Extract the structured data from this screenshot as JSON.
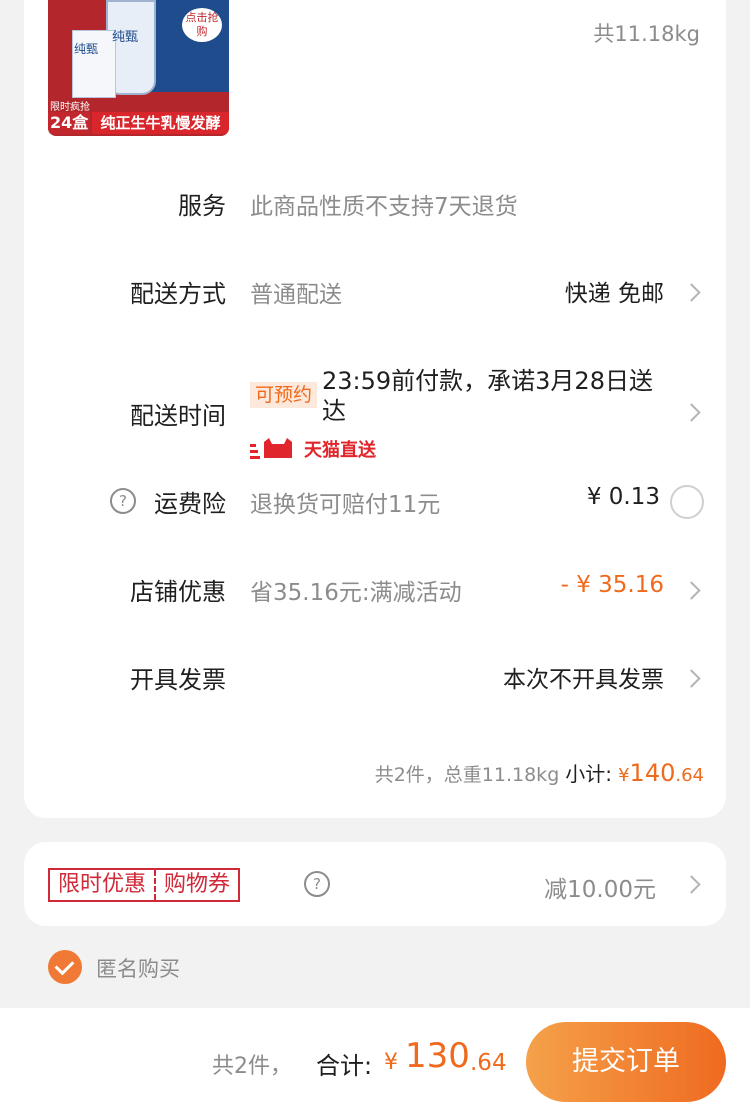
{
  "product": {
    "image_limit_text": "限时疯抢",
    "image_count": "24盒",
    "image_slogan": "纯正生牛乳慢发酵",
    "image_tag": "点击抢购",
    "image_box_text": "纯甄",
    "weight": "共11.18kg"
  },
  "service": {
    "label": "服务",
    "desc": "此商品性质不支持7天退货"
  },
  "delivery_method": {
    "label": "配送方式",
    "desc": "普通配送",
    "value": "快递 免邮"
  },
  "delivery_time": {
    "label": "配送时间",
    "badge": "可预约",
    "text": "23:59前付款，承诺3月28日送达",
    "service_name": "天猫直送"
  },
  "shipping_insurance": {
    "label": "运费险",
    "help_icon": "?",
    "desc": "退换货可赔付11元",
    "price": "¥ 0.13"
  },
  "store_discount": {
    "label": "店铺优惠",
    "desc": "省35.16元:满减活动",
    "value": "- ¥ 35.16"
  },
  "invoice": {
    "label": "开具发票",
    "value": "本次不开具发票"
  },
  "subtotal": {
    "summary": "共2件，总重11.18kg",
    "label": "小计:",
    "currency": "¥",
    "integer": "140",
    "decimal": ".64"
  },
  "coupon": {
    "tag_left": "限时优惠",
    "tag_right": "购物券",
    "help_icon": "?",
    "value": "减10.00元"
  },
  "anonymous": {
    "label": "匿名购买",
    "checked": true
  },
  "bottom_bar": {
    "count": "共2件，",
    "total_label": "合计:",
    "currency": "¥",
    "integer": "130",
    "decimal": ".64",
    "submit_label": "提交订单"
  },
  "colors": {
    "accent": "#ef6a1c",
    "brand_red": "#d02a3a",
    "tmall_red": "#e0262c"
  }
}
